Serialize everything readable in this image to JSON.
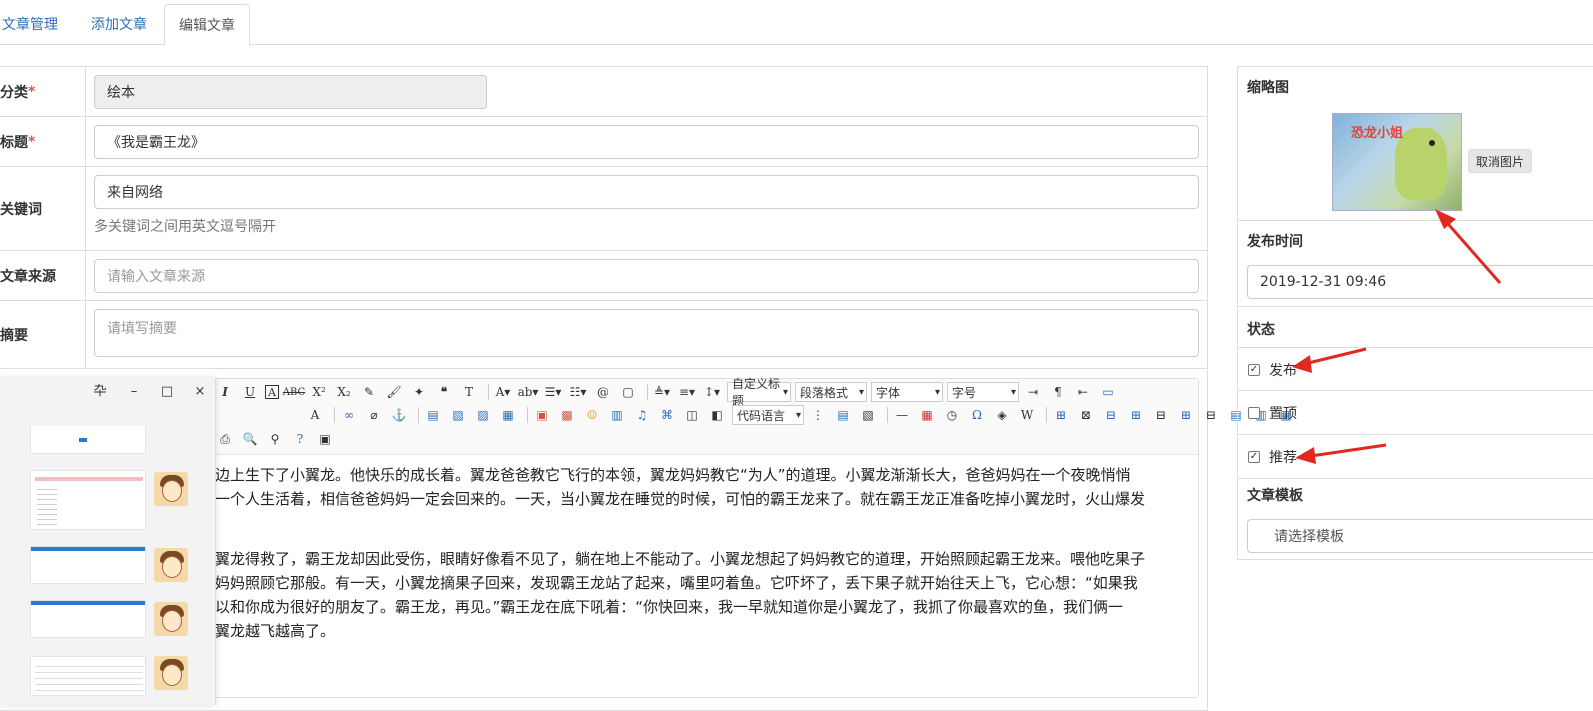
{
  "tabs": [
    "文章管理",
    "添加文章",
    "编辑文章"
  ],
  "form": {
    "category": {
      "label": "分类",
      "value": "绘本"
    },
    "title": {
      "label": "标题",
      "value": "《我是霸王龙》"
    },
    "keywords": {
      "label": "关键词",
      "value": "来自网络",
      "hint": "多关键词之间用英文逗号隔开"
    },
    "source": {
      "label": "文章来源",
      "placeholder": "请输入文章来源"
    },
    "summary": {
      "label": "摘要",
      "placeholder": "请填写摘要"
    },
    "required_mark": "*"
  },
  "editor": {
    "selects": {
      "custom_title": "自定义标题",
      "paragraph": "段落格式",
      "font": "字体",
      "size": "字号",
      "code_lang": "代码语言"
    },
    "paragraphs": [
      "边上生下了小翼龙。他快乐的成长着。翼龙爸爸教它飞行的本领，翼龙妈妈教它“为人”的道理。小翼龙渐渐长大，爸爸妈妈在一个夜晚悄悄",
      "一个人生活着，相信爸爸妈妈一定会回来的。一天，当小翼龙在睡觉的时候，可怕的霸王龙来了。就在霸王龙正准备吃掉小翼龙时，火山爆发",
      "翼龙得救了，霸王龙却因此受伤，眼睛好像看不见了，躺在地上不能动了。小翼龙想起了妈妈教它的道理，开始照顾起霸王龙来。喂他吃果子",
      "妈妈照顾它那般。有一天，小翼龙摘果子回来，发现霸王龙站了起来，嘴里叼着鱼。它吓坏了，丢下果子就开始往天上飞，它心想：“如果我",
      "以和你成为很好的朋友了。霸王龙，再见。”霸王龙在底下吼着：“你快回来，我一早就知道你是小翼龙了，我抓了你最喜欢的鱼，我们俩一",
      "翼龙越飞越高了。"
    ]
  },
  "sidebar": {
    "thumbnail_label": "缩略图",
    "thumbnail_cover_title": "恐龙小姐",
    "cancel_image": "取消图片",
    "publish_time_label": "发布时间",
    "publish_time": "2019-12-31 09:46",
    "status_label": "状态",
    "status": [
      {
        "label": "发布",
        "checked": true
      },
      {
        "label": "置顶",
        "checked": false
      },
      {
        "label": "推荐",
        "checked": true
      }
    ],
    "template_label": "文章模板",
    "template_placeholder": "请选择模板"
  },
  "window_controls": [
    "卆",
    "–",
    "□",
    "×"
  ],
  "colors": {
    "link": "#2d6fb8",
    "required": "#d9534f",
    "arrow": "#e02a1f",
    "accent": "#2a7ad3"
  }
}
